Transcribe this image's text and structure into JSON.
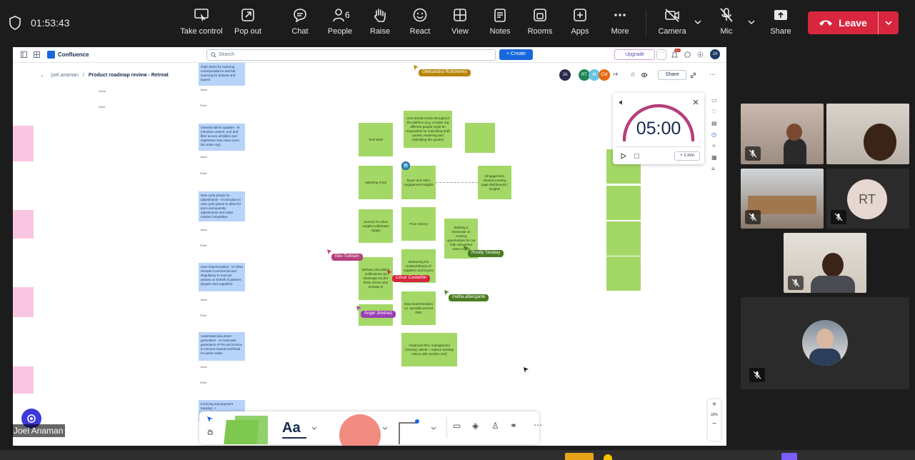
{
  "topbar": {
    "elapsed": "01:53:43",
    "buttons": {
      "take_control": "Take control",
      "pop_out": "Pop out",
      "chat": "Chat",
      "people": "People",
      "people_count": "6",
      "raise": "Raise",
      "react": "React",
      "view": "View",
      "notes": "Notes",
      "rooms": "Rooms",
      "apps": "Apps",
      "more": "More",
      "camera": "Camera",
      "mic": "Mic",
      "share": "Share",
      "leave": "Leave"
    },
    "leave_color": "#d7263d"
  },
  "confluence": {
    "app_name": "Confluence",
    "search_placeholder": "Search",
    "create": "+ Create",
    "upgrade": "Upgrade",
    "notif_badge": "9+",
    "breadcrumb_space": "joel.anaman",
    "breadcrumb_sep": "/",
    "page_title": "Product roadmap review - Retreat",
    "share": "Share",
    "avatars": [
      "JA",
      "RT",
      "M",
      "CM"
    ],
    "avatar_more": "+4",
    "user_avatar": "JA"
  },
  "whiteboard": {
    "green_stickies": [
      "Tech Debt",
      "User breadcrumbs throughout the platform (e.g. a trader org different people might be responsible for submitting draft quotes, tendering and submitting the quotes)",
      "Matching Fund",
      "Buyer and seller engagement insights",
      "[Engagement stream] Landing page dashboards / insights",
      "Journey for when supplier withdraws supply",
      "Price History",
      "Building a showcase on missing opportunities for not fully onboarded users to app",
      "Delivery all existing notifications via whatsapp too (for those clients who activate it)",
      "Measuring the trustworthiness of suppliers and buyers",
      "Data model iteration v2, specially around RMs",
      "Advanced SKU management (missing: delete + replace existing history with another one)"
    ],
    "blue_stickies": [
      "chain items by reducing correspondence and bid sourcing for hotseat and buyers",
      "General admin updates - III Introduce search, sort and filter across all tables and implement new views (user list under org)",
      "New cycle phase for adjustments - III Introduce a new cycle phase to allow for price and quantity adjustments and make market competitive",
      "User Impersonation - III Allow Hectare Commercial and Regulatory to execute actions on behalf of partners (buyers and suppliers)",
      "Automated document generation - III Automatic generation of PIs and invoice to remove manual workload for admin tasks",
      "Invoicing and payment tracking - I"
    ],
    "row_labels": {
      "value": "Value",
      "effort": "Effort"
    },
    "cursors": [
      "Oleksandra Rudchenko",
      "Ebo Turkson",
      "César Castañón",
      "Roudy Tarabay",
      "mattia.albergante",
      "Ángel Jiménez"
    ],
    "cursor_colors": {
      "oleksandra": "#b8860b",
      "ebo": "#b5407a",
      "cesar": "#d7263d",
      "roudy": "#4a7c22",
      "mattia": "#4a7c22",
      "angel": "#9b3fb6"
    },
    "dot_label": "M"
  },
  "timer": {
    "time": "05:00",
    "add_minute": "+ 1 min"
  },
  "zoom": {
    "plus": "+",
    "level": "33%",
    "minus": "−"
  },
  "toolbar": {
    "text_tool": "Aa"
  },
  "meeting": {
    "presenter_name": "Joel Anaman",
    "rt_initials": "RT"
  }
}
